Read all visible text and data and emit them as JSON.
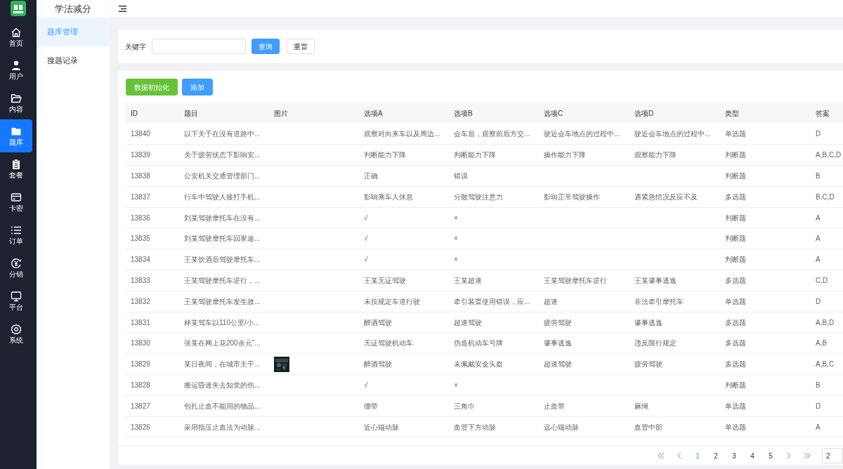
{
  "app": {
    "title": "学法减分"
  },
  "nav": [
    {
      "label": "首页",
      "selected": false
    },
    {
      "label": "用户",
      "selected": false
    },
    {
      "label": "内容",
      "selected": false
    },
    {
      "label": "题库",
      "selected": true
    },
    {
      "label": "套餐",
      "selected": false
    },
    {
      "label": "卡密",
      "selected": false
    },
    {
      "label": "订单",
      "selected": false
    },
    {
      "label": "分销",
      "selected": false
    },
    {
      "label": "平台",
      "selected": false
    },
    {
      "label": "系统",
      "selected": false
    }
  ],
  "submenu": [
    {
      "label": "题库管理",
      "selected": true
    },
    {
      "label": "搜题记录",
      "selected": false
    }
  ],
  "search": {
    "label": "关键字",
    "buttons": [
      {
        "label": "查询",
        "kind": "primary"
      },
      {
        "label": "重置",
        "kind": "plain"
      }
    ]
  },
  "actions": [
    {
      "label": "数据初始化",
      "kind": "success"
    },
    {
      "label": "添加",
      "kind": "primary"
    }
  ],
  "table": {
    "columns": [
      "ID",
      "题目",
      "图片",
      "选项A",
      "选项B",
      "选项C",
      "选项D",
      "类型",
      "答案"
    ],
    "rows": [
      {
        "id": "13840",
        "question": "以下关于在没有道路中...",
        "a": "观察对向来车以及周边...",
        "b": "会车后，观察前后方交...",
        "c": "驶近会车地点的过程中...",
        "d": "驶近会车地点的过程中...",
        "type": "单选题",
        "answer": "D"
      },
      {
        "id": "13839",
        "question": "关于疲劳状态下影响安...",
        "a": "判断能力下降",
        "b": "判断能力下降",
        "c": "操作能力下降",
        "d": "观察能力下降",
        "type": "判断题",
        "answer": "A,B,C,D"
      },
      {
        "id": "13838",
        "question": "公安机关交通管理部门...",
        "a": "正确",
        "b": "错误",
        "type": "判断题",
        "answer": "B"
      },
      {
        "id": "13837",
        "question": "行车中驾驶人接打手机...",
        "a": "影响乘车人休息",
        "b": "分散驾驶注意力",
        "c": "影响正常驾驶操作",
        "d": "遇紧急情况反应不及",
        "type": "多选题",
        "answer": "B,C,D"
      },
      {
        "id": "13836",
        "question": "刘某驾驶摩托车在没有...",
        "a": "√",
        "b": "×",
        "type": "判断题",
        "answer": "A"
      },
      {
        "id": "13835",
        "question": "刘某驾驶摩托车回家途...",
        "a": "√",
        "b": "×",
        "type": "判断题",
        "answer": "A"
      },
      {
        "id": "13834",
        "question": "王某饮酒后驾驶摩托车...",
        "a": "√",
        "b": "×",
        "type": "判断题",
        "answer": "A"
      },
      {
        "id": "13833",
        "question": "王某驾驶摩托车逆行，...",
        "a": "王某无证驾驶",
        "b": "王某超速",
        "c": "王某驾驶摩托车逆行",
        "d": "王某肇事逃逸",
        "type": "多选题",
        "answer": "C,D"
      },
      {
        "id": "13832",
        "question": "王某驾驶摩托车发生故...",
        "a": "未按规定车道行驶",
        "b": "牵引装置使用错误，应...",
        "c": "超速",
        "d": "非法牵引摩托车",
        "type": "单选题",
        "answer": "D"
      },
      {
        "id": "13831",
        "question": "林某驾车以110公里/小...",
        "a": "醉酒驾驶",
        "b": "超速驾驶",
        "c": "疲劳驾驶",
        "d": "肇事逃逸",
        "type": "多选题",
        "answer": "A,B,D"
      },
      {
        "id": "13830",
        "question": "张某在网上花200余元\"...",
        "a": "无证驾驶机动车",
        "b": "伪造机动车号牌",
        "c": "肇事逃逸",
        "d": "违反限行规定",
        "type": "多选题",
        "answer": "A,B"
      },
      {
        "id": "13829",
        "question": "某日夜间，在城市主干...",
        "a": "醉酒驾驶",
        "b": "未佩戴安全头盔",
        "c": "超速驾驶",
        "d": "疲劳驾驶",
        "type": "多选题",
        "answer": "A,B,C"
      },
      {
        "id": "13828",
        "question": "搬运昏迷失去知觉的伤...",
        "a": "√",
        "b": "×",
        "type": "判断题",
        "answer": "B"
      },
      {
        "id": "13827",
        "question": "包扎止血不能用的物品...",
        "a": "绷带",
        "b": "三角巾",
        "c": "止血带",
        "d": "麻绳",
        "type": "单选题",
        "answer": "D"
      },
      {
        "id": "13826",
        "question": "采用指压止血法为动脉...",
        "a": "近心端动脉",
        "b": "血管下方动脉",
        "c": "远心端动脉",
        "d": "血管中部",
        "type": "单选题",
        "answer": "A"
      }
    ]
  },
  "pagination": {
    "pages": [
      {
        "label": "1",
        "selected": true
      },
      {
        "label": "2",
        "selected": false
      },
      {
        "label": "3",
        "selected": false
      },
      {
        "label": "4",
        "selected": false
      },
      {
        "label": "5",
        "selected": false
      }
    ],
    "page_size": "2"
  }
}
